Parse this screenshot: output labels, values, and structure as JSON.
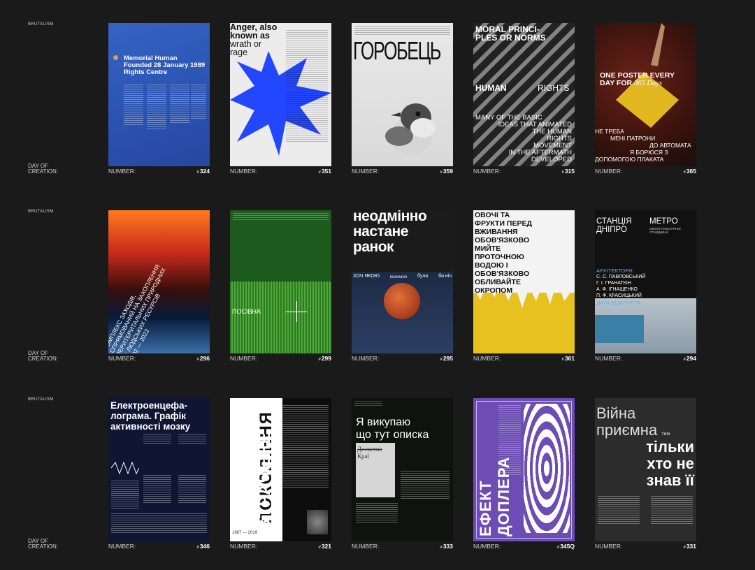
{
  "rows": [
    {
      "tag": "BRUTALISM",
      "day_label_1": "DAY OF",
      "day_label_2": "CREATION:"
    },
    {
      "tag": "BRUTALISM",
      "day_label_1": "DAY OF",
      "day_label_2": "CREATION:"
    },
    {
      "tag": "BRUTALISM",
      "day_label_1": "DAY OF",
      "day_label_2": "CREATION:"
    }
  ],
  "number_label": "NUMBER:",
  "posters": {
    "p324": {
      "number": "324",
      "title_1": "Memorial Human",
      "title_2": "Founded 28 January 1989",
      "title_3": "Rights Centre",
      "accent": "#2a52b0"
    },
    "p351": {
      "number": "351",
      "title_1": "Anger, also",
      "title_2": "known as",
      "title_3": "wrath or",
      "title_4": "rage",
      "accent": "#2347ff"
    },
    "p359": {
      "number": "359",
      "title": "ГОРОБЕЦЬ"
    },
    "p315": {
      "number": "315",
      "title_1": "MORAL PRINCI-",
      "title_2": "PLES OR NORMS",
      "word_1": "HUMAN",
      "word_2": "RIGHTS",
      "body_1": "MANY OF THE BASIC",
      "body_2": "IDEAS THAT ANIMATED",
      "body_3": "THE HUMAN",
      "body_4": "RIGHTS",
      "body_5": "MOVEMENT",
      "body_6": "IN THE AFTERMATH",
      "body_7": "DEVELOPED"
    },
    "p365": {
      "number": "365",
      "title_1": "ONE POSTER EVERY",
      "title_2": "DAY FOR",
      "title_3": "365 Days",
      "l1": "НЕ ТРЕБА",
      "l2": "МЕНІ ПАТРОНИ",
      "l3": "ДО",
      "l4": "АВТОМАТА",
      "l5": "Я",
      "l6": "БОРЮСЯ З",
      "l7": "ДОПОМОГОЮ ПЛАКАТА"
    },
    "p296": {
      "number": "296",
      "title_1": "КОМПЛЕКС ЗАХОДІВ,",
      "title_2": "СПРЯМОВАНИЙ НА ЗАХОПЛЕННЯ",
      "title_3": "ПЕРИТЕРИТАЛЬНИХ ПРИРОДНИХ",
      "title_4": "ТА ЛЮДСЬКИХ РЕСУРСІВ",
      "date": "24.02 — 2022"
    },
    "p299": {
      "number": "299",
      "title": "ПОСІВНА"
    },
    "p295": {
      "number": "295",
      "title_1": "неодмінно",
      "title_2": "настане",
      "title_3": "ранок",
      "w1": "ХОЧ ЯКОЮ",
      "w2": "темною",
      "w3": "була",
      "w4": "би ніч"
    },
    "p361": {
      "number": "361",
      "l1": "ОВОЧІ ТА",
      "l2": "ФРУКТИ ПЕРЕД",
      "l3": "ВЖИВАННЯ",
      "l4": "ОБОВ'ЯЗКОВО",
      "l5": "МИЙТЕ",
      "l6": "ПРОТОЧНОЮ",
      "l7": "ВОДОЮ І",
      "l8": "ОБОВ'ЯЗКОВО",
      "l9": "ОБЛИВАЙТЕ",
      "l10": "ОКРОПОМ"
    },
    "p294": {
      "number": "294",
      "t1": "СТАНЦІЯ",
      "t2": "ДНІПРО",
      "t3": "МЕТРО",
      "sub": "ОБ'ЄКТ КУЛЬТУРНОЇ СПАДЩИНИ",
      "arch": "АРХІТЕКТОРИ:",
      "a1": "С. С. ПАВЛОВСЬКИЙ",
      "a2": "Г. І. ГРАНАТКІН",
      "a3": "А. Ф. ІГНАЩЕНКО",
      "a4": "П. Ф. КРАСИЦЬКИЙ",
      "open": "ДАТА ВІДКРИТТЯ:"
    },
    "p346": {
      "number": "346",
      "title_1": "Електроенцефа-",
      "title_2": "лограма. Графік",
      "title_3": "активності мозку"
    },
    "p321": {
      "number": "321",
      "title_1": "ПОКОЛІННЯ",
      "title_2": "ВТРАЧЕНЕ",
      "years": "1987 — 2019"
    },
    "p333": {
      "number": "333",
      "title_1": "Я викупаю",
      "title_2": "що тут описка",
      "sign_1": "Досвство",
      "sign_2": "Краї"
    },
    "p345": {
      "number": "345Q",
      "title_1": "ЕФЕКТ ДОПЛЕРА"
    },
    "p331": {
      "number": "331",
      "l1": "Війна",
      "l2": "приємна",
      "l3": "тим",
      "l4": "тільки",
      "l5": "хто не",
      "l6": "знав її"
    }
  }
}
